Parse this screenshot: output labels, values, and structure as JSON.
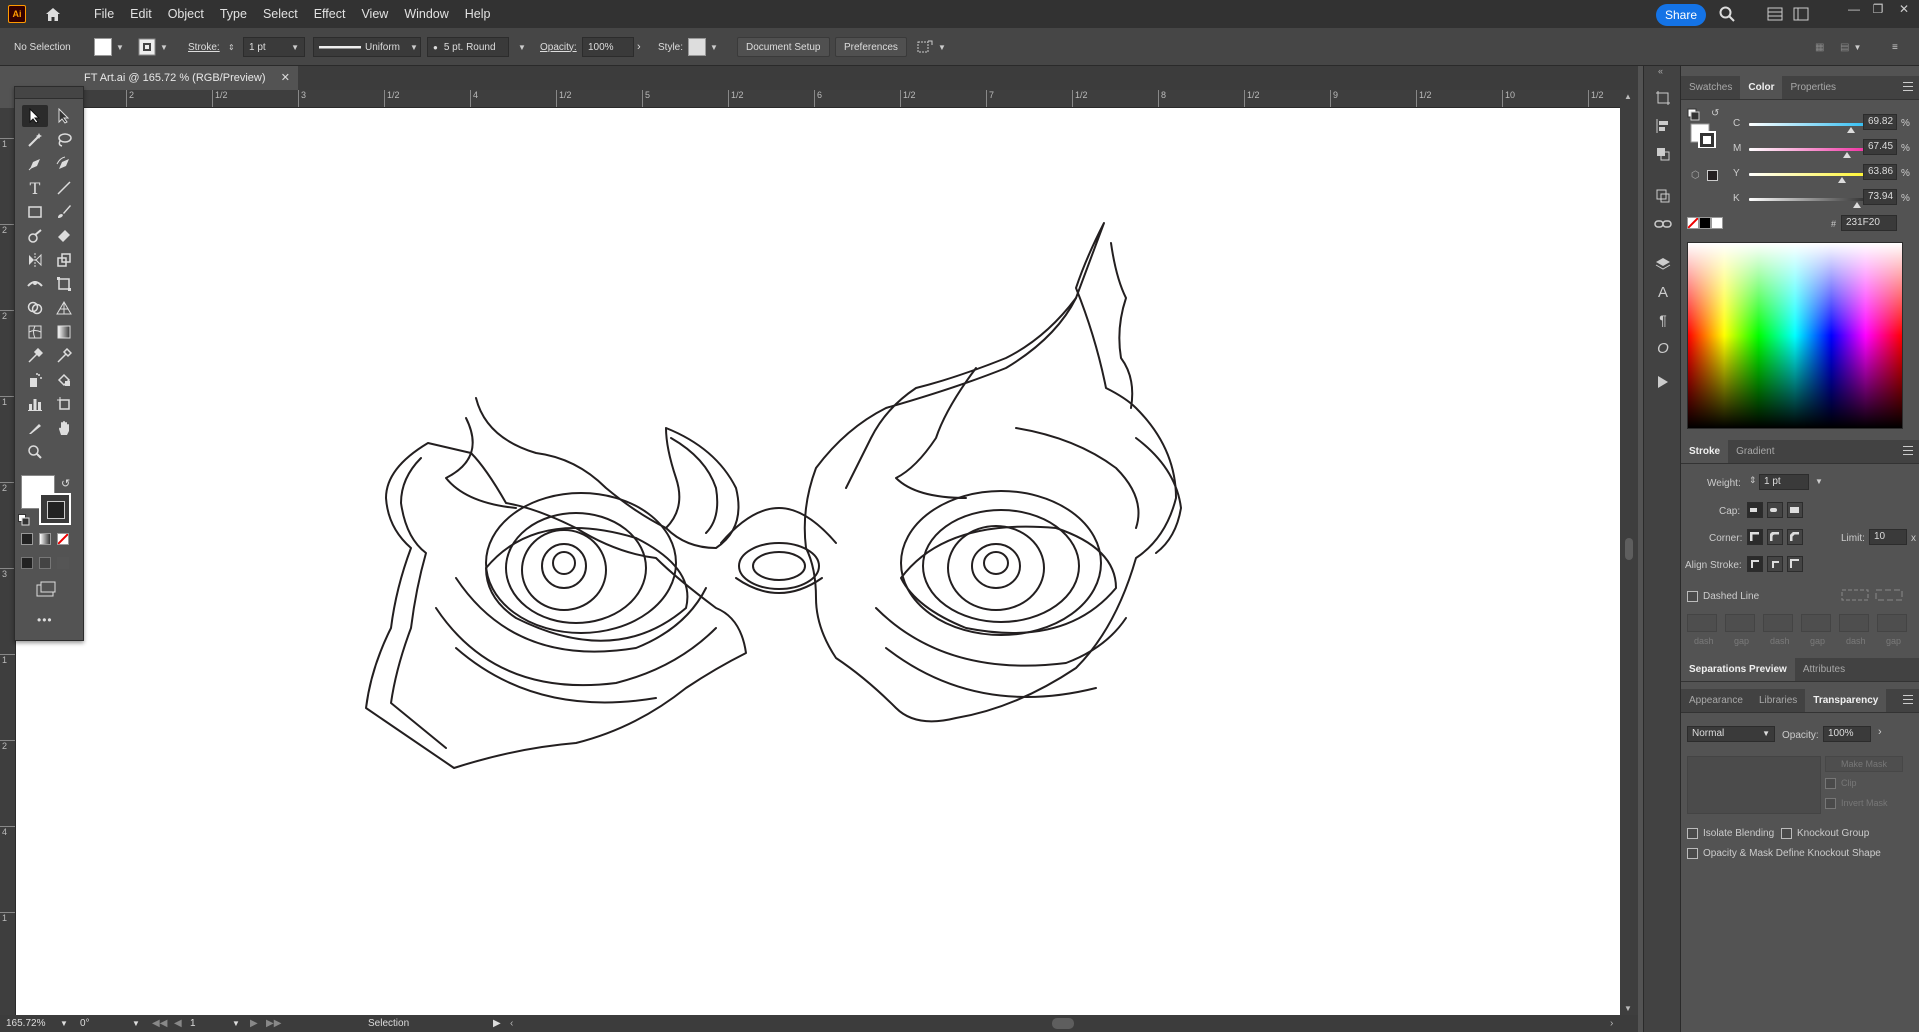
{
  "app": {
    "logo_text": "Ai",
    "menus": [
      "File",
      "Edit",
      "Object",
      "Type",
      "Select",
      "Effect",
      "View",
      "Window",
      "Help"
    ],
    "share_label": "Share"
  },
  "control_bar": {
    "selection": "No Selection",
    "stroke_label": "Stroke:",
    "stroke_weight": "1 pt",
    "profile": "Uniform",
    "brush": "5 pt. Round",
    "opacity_label": "Opacity:",
    "opacity": "100%",
    "style_label": "Style:",
    "document_setup": "Document Setup",
    "preferences": "Preferences"
  },
  "document": {
    "tab_title": "FT Art.ai @ 165.72 % (RGB/Preview)",
    "ruler_h": [
      "2",
      "1/2",
      "3",
      "1/2",
      "4",
      "1/2",
      "5",
      "1/2",
      "6",
      "1/2",
      "7",
      "1/2",
      "8",
      "1/2",
      "9",
      "1/2",
      "10",
      "1/2",
      "11"
    ],
    "ruler_v": [
      "1",
      "2",
      "2",
      "1",
      "2",
      "3",
      "1",
      "2",
      "4",
      "1",
      "2",
      "5",
      "1",
      "2",
      "6"
    ],
    "status": {
      "zoom": "165.72%",
      "rotation": "0°",
      "artboard": "1",
      "tool": "Selection"
    }
  },
  "color_panel": {
    "tabs": [
      "Swatches",
      "Color",
      "Properties"
    ],
    "active_tab": "Color",
    "channels": [
      {
        "label": "C",
        "value": "69.82",
        "unit": "%",
        "level": 0.6982
      },
      {
        "label": "M",
        "value": "67.45",
        "unit": "%",
        "level": 0.6745
      },
      {
        "label": "Y",
        "value": "63.86",
        "unit": "%",
        "level": 0.6386
      },
      {
        "label": "K",
        "value": "73.94",
        "unit": "%",
        "level": 0.7394
      }
    ],
    "hex": "231F20",
    "current_color": "#231f20"
  },
  "stroke_panel": {
    "tabs": [
      "Stroke",
      "Gradient"
    ],
    "weight_label": "Weight:",
    "weight": "1 pt",
    "cap_label": "Cap:",
    "corner_label": "Corner:",
    "limit_label": "Limit:",
    "limit": "10",
    "limit_unit": "x",
    "align_label": "Align Stroke:",
    "dashed_line": "Dashed Line",
    "dash_labels": [
      "dash",
      "gap",
      "dash",
      "gap",
      "dash",
      "gap"
    ]
  },
  "separations": {
    "tabs": [
      "Separations Preview",
      "Attributes"
    ]
  },
  "transparency_panel": {
    "tabs": [
      "Appearance",
      "Libraries",
      "Transparency"
    ],
    "blend_mode": "Normal",
    "opacity_label": "Opacity:",
    "opacity": "100%",
    "make_mask": "Make Mask",
    "clip": "Clip",
    "invert_mask": "Invert Mask",
    "isolate_blending": "Isolate Blending",
    "knockout_group": "Knockout Group",
    "opacity_mask_define": "Opacity & Mask Define Knockout Shape"
  }
}
